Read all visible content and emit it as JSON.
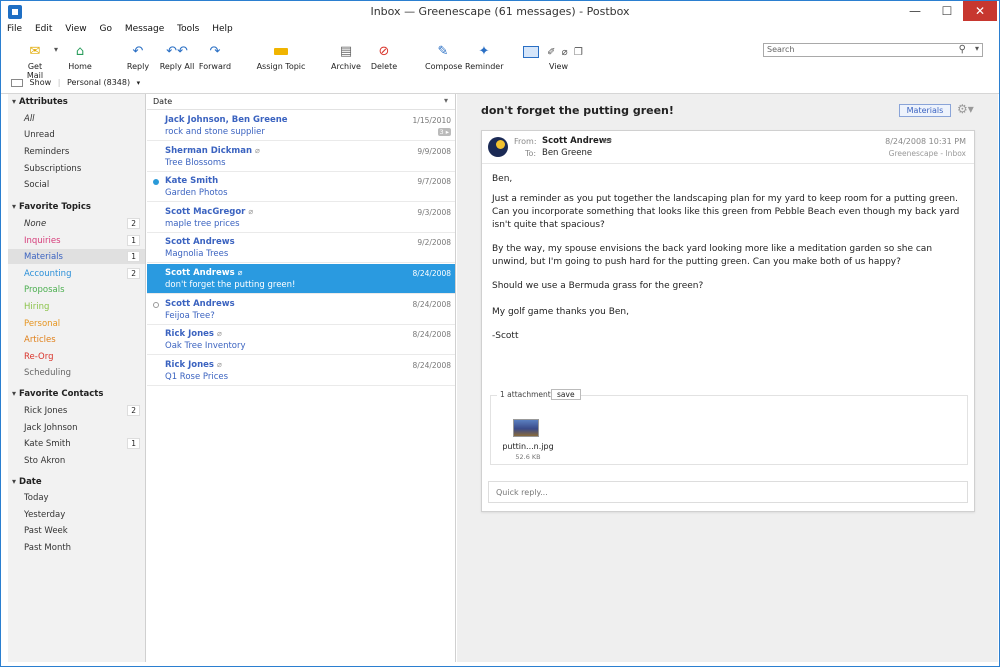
{
  "window": {
    "title": "Inbox — Greenescape (61 messages) - Postbox",
    "min": "—",
    "max": "☐",
    "close": "✕"
  },
  "menu": [
    "File",
    "Edit",
    "View",
    "Go",
    "Message",
    "Tools",
    "Help"
  ],
  "toolbar": {
    "get_mail": "Get Mail",
    "home": "Home",
    "reply": "Reply",
    "reply_all": "Reply All",
    "forward": "Forward",
    "assign_topic": "Assign Topic",
    "archive": "Archive",
    "delete": "Delete",
    "compose": "Compose",
    "reminder": "Reminder",
    "view": "View"
  },
  "search": {
    "placeholder": "Search"
  },
  "showbar": {
    "show": "Show",
    "account": "Personal (8348)"
  },
  "sidebar": {
    "attributes": {
      "title": "Attributes",
      "items": [
        "All",
        "Unread",
        "Reminders",
        "Subscriptions",
        "Social"
      ]
    },
    "topics": {
      "title": "Favorite Topics",
      "items": [
        {
          "label": "None",
          "count": "2",
          "color": "#333333"
        },
        {
          "label": "Inquiries",
          "count": "1",
          "color": "#d63c7a"
        },
        {
          "label": "Materials",
          "count": "1",
          "color": "#3b63c0"
        },
        {
          "label": "Accounting",
          "count": "2",
          "color": "#2a8fd8"
        },
        {
          "label": "Proposals",
          "count": "",
          "color": "#4caf50"
        },
        {
          "label": "Hiring",
          "count": "",
          "color": "#8bc34a"
        },
        {
          "label": "Personal",
          "count": "",
          "color": "#e69520"
        },
        {
          "label": "Articles",
          "count": "",
          "color": "#e0801a"
        },
        {
          "label": "Re-Org",
          "count": "",
          "color": "#d9342b"
        },
        {
          "label": "Scheduling",
          "count": "",
          "color": "#666666"
        }
      ]
    },
    "contacts": {
      "title": "Favorite Contacts",
      "items": [
        {
          "label": "Rick Jones",
          "count": "2"
        },
        {
          "label": "Jack Johnson",
          "count": ""
        },
        {
          "label": "Kate Smith",
          "count": "1"
        },
        {
          "label": "Sto Akron",
          "count": ""
        }
      ]
    },
    "date": {
      "title": "Date",
      "items": [
        "Today",
        "Yesterday",
        "Past Week",
        "Past Month"
      ]
    }
  },
  "list": {
    "header": "Date",
    "messages": [
      {
        "from": "Jack Johnson, Ben Greene",
        "subject": "rock and stone supplier",
        "date": "1/15/2010",
        "thread": "3 ▸"
      },
      {
        "from": "Sherman Dickman",
        "subject": "Tree Blossoms",
        "date": "9/9/2008"
      },
      {
        "from": "Kate Smith",
        "subject": "Garden Photos",
        "date": "9/7/2008"
      },
      {
        "from": "Scott MacGregor",
        "subject": "maple tree prices",
        "date": "9/3/2008"
      },
      {
        "from": "Scott Andrews",
        "subject": "Magnolia Trees",
        "date": "9/2/2008"
      },
      {
        "from": "Scott Andrews",
        "subject": "don't forget the putting green!",
        "date": "8/24/2008"
      },
      {
        "from": "Scott Andrews",
        "subject": "Feijoa Tree?",
        "date": "8/24/2008"
      },
      {
        "from": "Rick Jones",
        "subject": "Oak Tree Inventory",
        "date": "8/24/2008"
      },
      {
        "from": "Rick Jones",
        "subject": "Q1 Rose Prices",
        "date": "8/24/2008"
      }
    ]
  },
  "reader": {
    "subject": "don't forget the putting green!",
    "tag": "Materials",
    "from_label": "From:",
    "from": "Scott Andrews",
    "to_label": "To:",
    "to": "Ben Greene",
    "date": "8/24/2008 10:31 PM",
    "location": "Greenescape - Inbox",
    "body": [
      "Ben,",
      "Just a reminder as you put together the landscaping plan for my yard to keep room for a putting green. Can you incorporate something that looks like this green from Pebble Beach even though my back yard isn't quite that spacious?",
      "By the way, my spouse envisions the back yard looking more like a meditation garden so she can unwind, but I'm going to push hard for the putting green. Can you make both of us happy?",
      "Should we use a Bermuda grass for the green?",
      "My golf game thanks you Ben,",
      "-Scott"
    ],
    "attachment_count": "1 attachment",
    "save": "save",
    "attachment_name": "puttin...n.jpg",
    "attachment_size": "52.6 KB",
    "quick_reply": "Quick reply..."
  }
}
